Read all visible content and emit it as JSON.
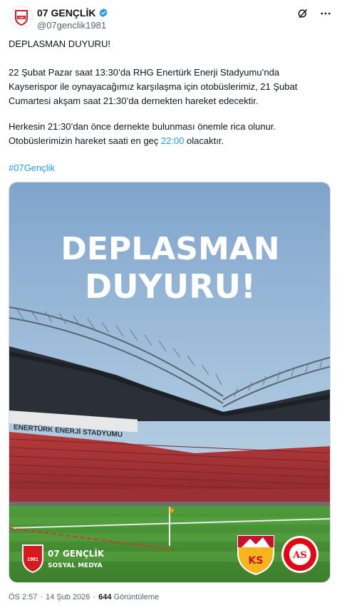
{
  "tweet": {
    "author_name": "07 GENÇLİK",
    "author_handle": "@07genclik1981",
    "avatar_label": "1981",
    "paragraph1": "DEPLASMAN DUYURU!",
    "paragraph2_line1": "22 Şubat Pazar saat 13:30’da RHG Enertürk Enerji Stadyumu’nda",
    "paragraph2_line2": "Kayserispor ile oynayacağımız karşılaşma için otobüslerimiz, 21 Şubat",
    "paragraph2_line3": "Cumartesi akşam saat 21:30’da dernekten hareket edecektir.",
    "paragraph3_line1": "Herkesin 21:30’dan önce dernekte bulunması önemle rica olunur.",
    "paragraph3_line2_a": "Otobüslerimizin hareket saati en geç ",
    "paragraph3_line2_time": "22:00",
    "paragraph3_line2_b": " olacaktır.",
    "hashtag": "#07Gençlik"
  },
  "media": {
    "headline_1": "DEPLASMAN",
    "headline_2": "DUYURU!",
    "stadium_banner": "ENERTÜRK ENERJİ STADYUMU",
    "logo_text_1": "07 GENÇLİK",
    "logo_text_2": "SOSYAL MEDYA",
    "badge_left": "1981",
    "kayseri_logo": "KS",
    "antalya_logo": "AS"
  },
  "footer": {
    "time": "ÖS 2:57",
    "separator": "·",
    "date": "14 Şub 2026",
    "views_count": "644",
    "views_label": "Görüntüleme"
  },
  "colors": {
    "accent": "#1d9bf0",
    "brand_red": "#d71920",
    "text_primary": "#0f1419",
    "text_secondary": "#536471"
  },
  "icons": {
    "verified": "verified-badge-icon",
    "grok": "grok-icon",
    "more": "more-icon"
  }
}
